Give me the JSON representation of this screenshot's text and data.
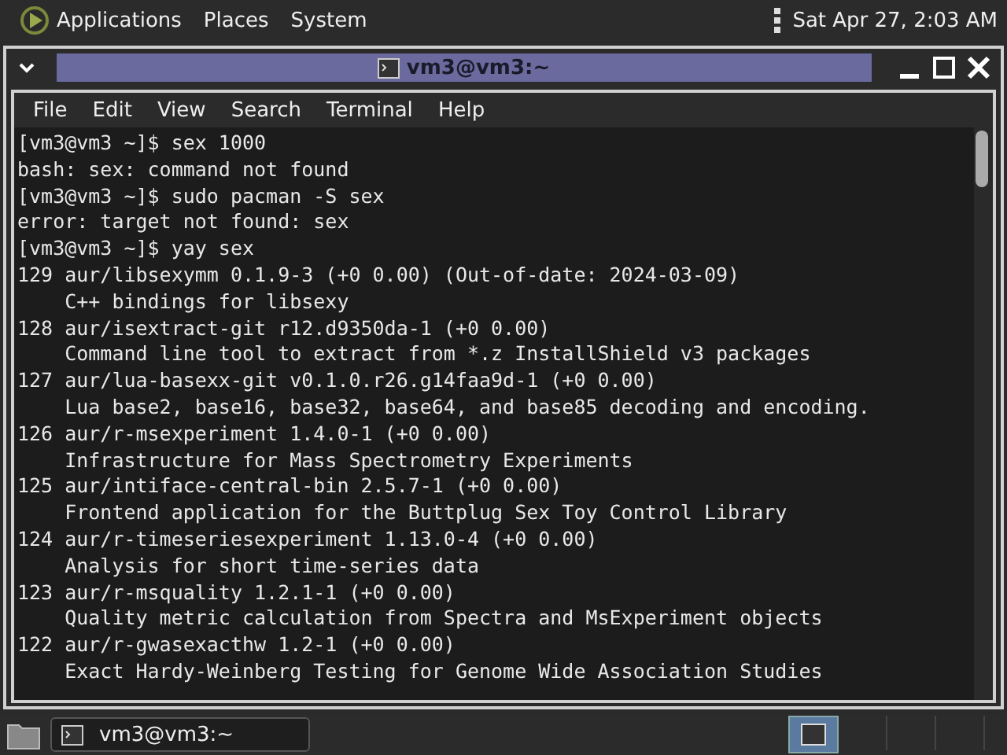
{
  "top_panel": {
    "menus": [
      "Applications",
      "Places",
      "System"
    ],
    "clock": "Sat Apr 27,  2:03 AM"
  },
  "window": {
    "title": "vm3@vm3:~"
  },
  "menu_bar": [
    "File",
    "Edit",
    "View",
    "Search",
    "Terminal",
    "Help"
  ],
  "terminal": {
    "lines": [
      "[vm3@vm3 ~]$ sex 1000",
      "bash: sex: command not found",
      "[vm3@vm3 ~]$ sudo pacman -S sex",
      "error: target not found: sex",
      "[vm3@vm3 ~]$ yay sex",
      "129 aur/libsexymm 0.1.9-3 (+0 0.00) (Out-of-date: 2024-03-09)",
      "    C++ bindings for libsexy",
      "128 aur/isextract-git r12.d9350da-1 (+0 0.00)",
      "    Command line tool to extract from *.z InstallShield v3 packages",
      "127 aur/lua-basexx-git v0.1.0.r26.g14faa9d-1 (+0 0.00)",
      "    Lua base2, base16, base32, base64, and base85 decoding and encoding.",
      "126 aur/r-msexperiment 1.4.0-1 (+0 0.00)",
      "    Infrastructure for Mass Spectrometry Experiments",
      "125 aur/intiface-central-bin 2.5.7-1 (+0 0.00)",
      "    Frontend application for the Buttplug Sex Toy Control Library",
      "124 aur/r-timeseriesexperiment 1.13.0-4 (+0 0.00)",
      "    Analysis for short time-series data",
      "123 aur/r-msquality 1.2.1-1 (+0 0.00)",
      "    Quality metric calculation from Spectra and MsExperiment objects",
      "122 aur/r-gwasexacthw 1.2-1 (+0 0.00)",
      "    Exact Hardy-Weinberg Testing for Genome Wide Association Studies"
    ]
  },
  "taskbar": {
    "tasks": [
      {
        "label": "vm3@vm3:~"
      }
    ],
    "workspaces": [
      {
        "selected": true
      },
      {
        "selected": false
      },
      {
        "selected": false
      },
      {
        "selected": false
      }
    ]
  }
}
